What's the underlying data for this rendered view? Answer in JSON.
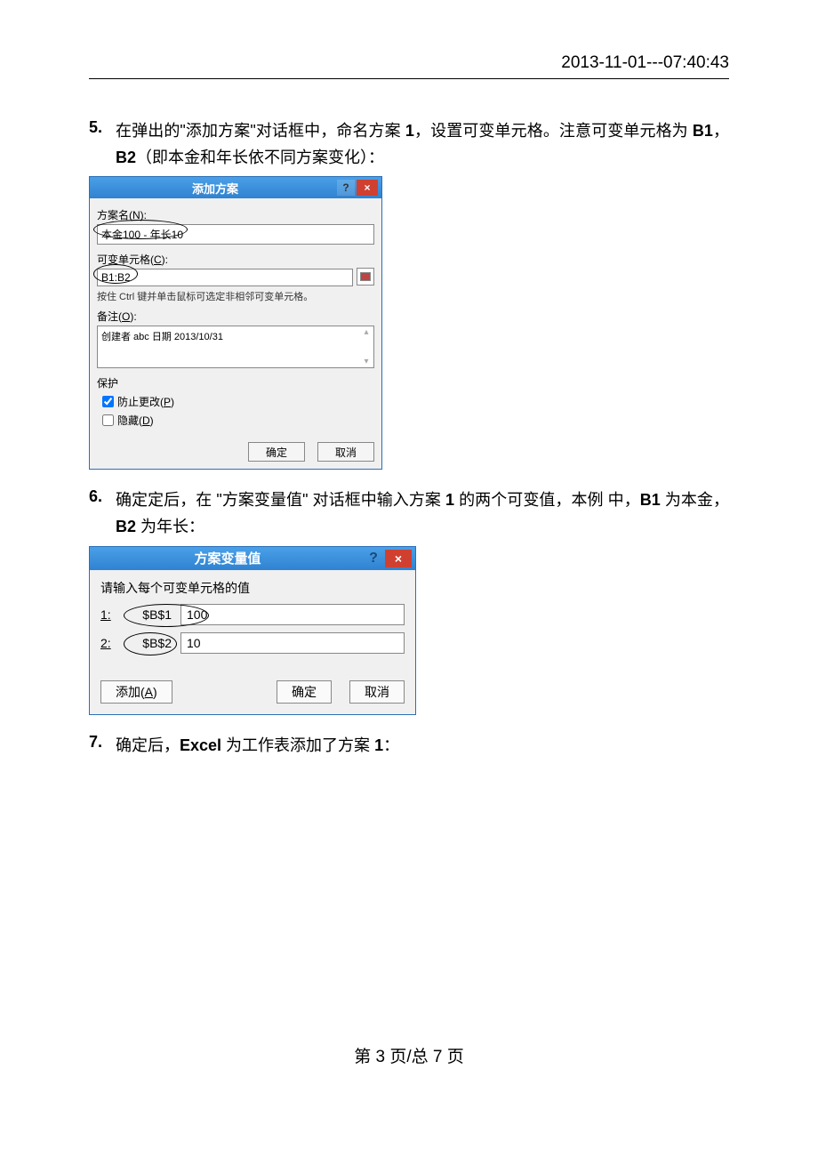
{
  "header": {
    "timestamp": "2013-11-01---07:40:43"
  },
  "steps": {
    "s5": {
      "num": "5.",
      "text_a": "在弹出的\"添加方案\"对话框中，命名方案 ",
      "text_b": "1",
      "text_c": "，设置可变单元格。注意可变单元格为 ",
      "text_d": "B1",
      "text_e": "，",
      "text_f": "B2",
      "text_g": "（即本金和年长依不同方案变化）："
    },
    "s6": {
      "num": "6.",
      "text_a": "确定定后，在 \"方案变量值\" 对话框中输入方案 ",
      "text_b": "1",
      "text_c": " 的两个可变值，本例 中，",
      "text_d": "B1",
      "text_e": " 为本金，",
      "text_f": "B2",
      "text_g": " 为年长："
    },
    "s7": {
      "num": "7.",
      "text_a": "确定后，",
      "text_b": "Excel",
      "text_c": " 为工作表添加了方案 ",
      "text_d": "1",
      "text_e": "："
    }
  },
  "dlg1": {
    "title": "添加方案",
    "help": "?",
    "close": "×",
    "name_label_a": "方案名(",
    "name_label_u": "N",
    "name_label_b": "):",
    "name_value": "本金100 - 年长10",
    "cells_label_a": "可变单元格(",
    "cells_label_u": "C",
    "cells_label_b": "):",
    "cells_value": "B1:B2",
    "hint": "按住 Ctrl 键并单击鼠标可选定非相邻可变单元格。",
    "notes_label_a": "备注(",
    "notes_label_u": "O",
    "notes_label_b": "):",
    "notes_value": "创建者 abc 日期 2013/10/31",
    "protect_label": "保护",
    "chk1_a": "防止更改(",
    "chk1_u": "P",
    "chk1_b": ")",
    "chk1_checked": true,
    "chk2_a": "隐藏(",
    "chk2_u": "D",
    "chk2_b": ")",
    "chk2_checked": false,
    "ok": "确定",
    "cancel": "取消"
  },
  "dlg2": {
    "title": "方案变量值",
    "help": "?",
    "close": "×",
    "prompt": "请输入每个可变单元格的值",
    "rows": [
      {
        "idx": "1:",
        "cell": "$B$1",
        "val": "100"
      },
      {
        "idx": "2:",
        "cell": "$B$2",
        "val": "10"
      }
    ],
    "add_a": "添加(",
    "add_u": "A",
    "add_b": ")",
    "ok": "确定",
    "cancel": "取消"
  },
  "footer": {
    "text": "第 3 页/总 7 页"
  }
}
